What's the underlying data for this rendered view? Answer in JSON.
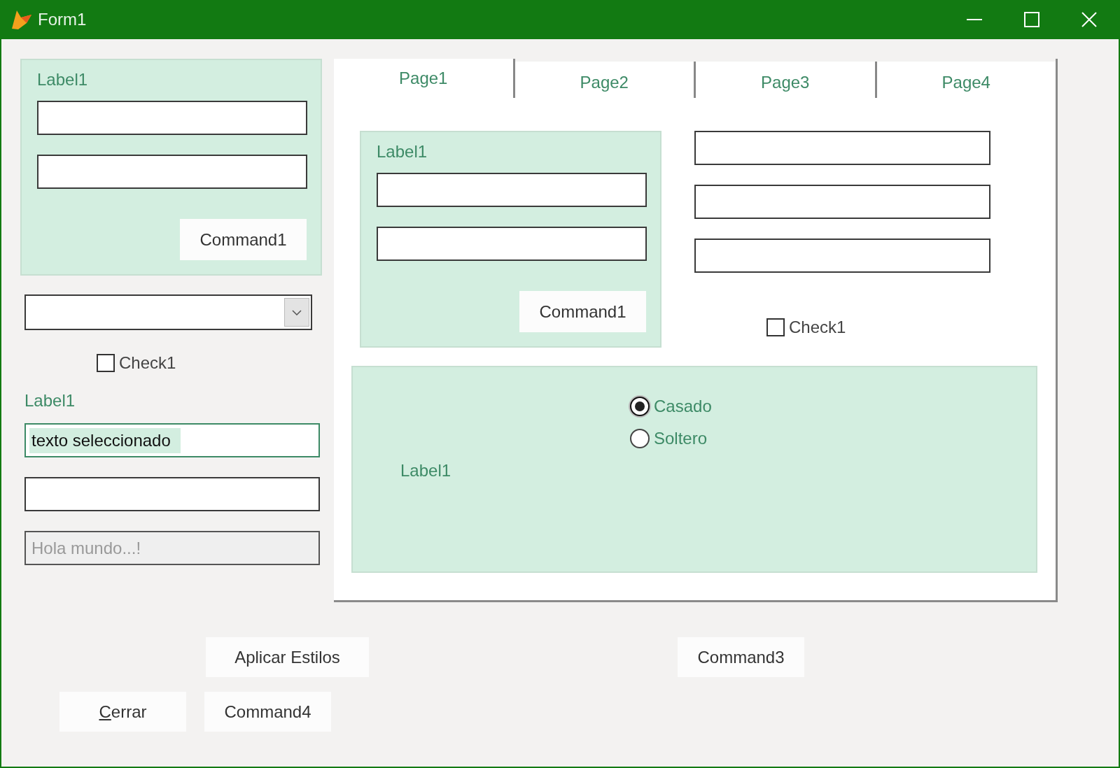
{
  "window": {
    "title": "Form1"
  },
  "left_container": {
    "label": "Label1",
    "fields": [
      {
        "kind": "textbox"
      },
      {
        "kind": "textbox"
      }
    ],
    "button": "Command1"
  },
  "left_check": {
    "label": "Check1",
    "checked": false
  },
  "left_label": "Label1",
  "left_textboxes": [
    {
      "value": "texto seleccionado",
      "selected": true,
      "disabled": false
    },
    {
      "selected": false,
      "disabled": false
    },
    {
      "value": "Hola mundo...!",
      "selected": false,
      "disabled": true
    }
  ],
  "pageframe": {
    "tabs": [
      {
        "label": "Page1",
        "selected": true
      },
      {
        "label": "Page2",
        "selected": false
      },
      {
        "label": "Page3",
        "selected": false
      },
      {
        "label": "Page4",
        "selected": false
      }
    ],
    "inner_container": {
      "label": "Label1",
      "fields": [
        {
          "kind": "textbox"
        },
        {
          "kind": "textbox"
        }
      ],
      "button": "Command1"
    },
    "right_fields": [
      {
        "kind": "textbox"
      },
      {
        "kind": "textbox"
      },
      {
        "kind": "textbox"
      }
    ],
    "check": {
      "label": "Check1",
      "checked": false
    },
    "option_group": {
      "options": [
        {
          "label": "Casado",
          "selected": true
        },
        {
          "label": "Soltero",
          "selected": false
        }
      ],
      "label": "Label1"
    }
  },
  "buttons_row1": [
    {
      "label": "Aplicar Estilos"
    },
    {
      "label": "Command3"
    }
  ],
  "buttons_row2": [
    {
      "hotkey": "C",
      "label": "errar"
    },
    {
      "label": "Command4"
    }
  ]
}
